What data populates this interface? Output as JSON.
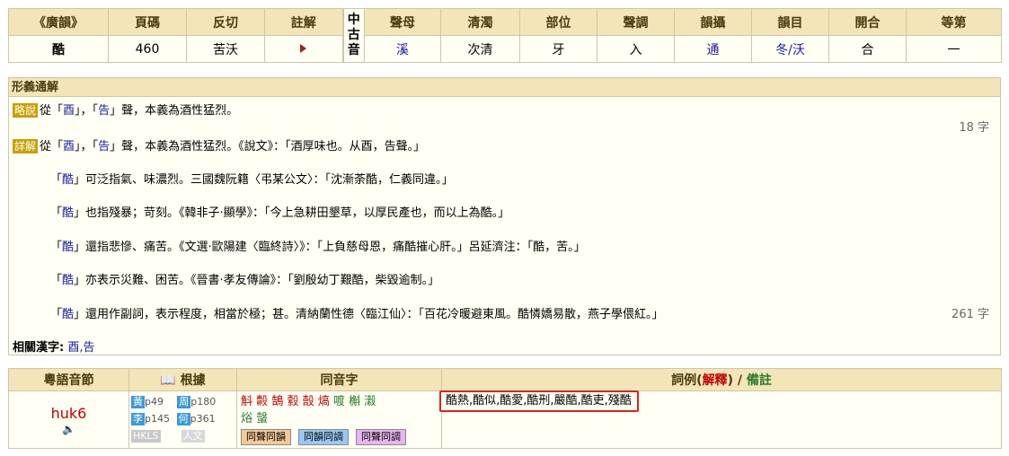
{
  "top": {
    "headers": [
      "《廣韻》",
      "頁碼",
      "反切",
      "註解",
      "聲母",
      "清濁",
      "部位",
      "聲調",
      "韻攝",
      "韻目",
      "開合",
      "等第"
    ],
    "mid_label": [
      "中",
      "古",
      "音"
    ],
    "values": {
      "char": "酷",
      "page": "460",
      "fanqie": "苦沃",
      "initial": "溪",
      "qingzhuo": "次清",
      "buwei": "牙",
      "tone": "入",
      "yunshe": "通",
      "yunmu": "冬/沃",
      "kaihe": "合",
      "dengdi": "一"
    }
  },
  "xingyi": {
    "title": "形義通解",
    "brief_tag": "略說",
    "brief": {
      "p1": "從「",
      "c1": "酉",
      "p2": "」，「",
      "c2": "告",
      "p3": "」聲，本義為酒性猛烈。"
    },
    "brief_count": "18 字",
    "detail_tag": "詳解",
    "detail": {
      "p1": "從「",
      "c1": "酉",
      "p2": "」，「",
      "c2": "告",
      "p3": "」聲，本義為酒性猛烈。《說文》：「酒厚味也。从酉，告聲。」"
    },
    "senses": [
      {
        "char": "酷",
        "text": "」可泛指氣、味濃烈。三國魏阮籍〈弔某公文〉：「沈漸荼酷，仁義同違。」"
      },
      {
        "char": "酷",
        "text": "」也指殘暴；苛刻。《韓非子·顯學》：「今上急耕田墾草，以厚民產也，而以上為酷。」"
      },
      {
        "char": "酷",
        "text": "」還指悲慘、痛苦。《文選·歐陽建〈臨終詩〉》：「上負慈母恩，痛酷摧心肝。」呂延濟注：「酷，苦。」"
      },
      {
        "char": "酷",
        "text": "」亦表示災難、困苦。《晉書·孝友傳論》：「劉殷幼丁艱酷，柴毀逾制。」"
      },
      {
        "char": "酷",
        "text": "」還用作副詞，表示程度，相當於極；甚。清納蘭性德〈臨江仙〉：「百花冷暖避東風。酷憐嬌易散，燕子學偎紅。」"
      }
    ],
    "detail_count": "261 字",
    "related_label": "相關漢字:",
    "related": "酉,告"
  },
  "bottom": {
    "headers": {
      "yue": "粵語音節",
      "basis": "根據",
      "homophone": "同音字",
      "cili": "詞例",
      "jieshi": "解釋",
      "sep": " / ",
      "beizhu": "備註"
    },
    "book_icon": "book-icon",
    "yue": "huk6",
    "sources": [
      {
        "tag": "黃",
        "page": "p49",
        "color": "#3a9ad9"
      },
      {
        "tag": "周",
        "page": "p180",
        "color": "#3a9ad9"
      },
      {
        "tag": "李",
        "page": "p145",
        "color": "#3a9ad9"
      },
      {
        "tag": "何",
        "page": "p361",
        "color": "#3a9ad9"
      },
      {
        "tag": "HKLS",
        "page": "",
        "color": "#c8c8c8"
      },
      {
        "tag": "人文",
        "page": "",
        "color": "#d8d8d8"
      }
    ],
    "homophones_line1": [
      "斛",
      "㲉",
      "鵠",
      "縠",
      "嗀",
      "熇",
      "喥",
      "槲",
      "瀫"
    ],
    "homophones_line2": [
      "焀",
      "螜"
    ],
    "buttons": [
      "同聲同韻",
      "同韻同調",
      "同聲同調"
    ],
    "examples": "酷熱,酷似,酷愛,酷刑,嚴酷,酷吏,殘酷"
  }
}
